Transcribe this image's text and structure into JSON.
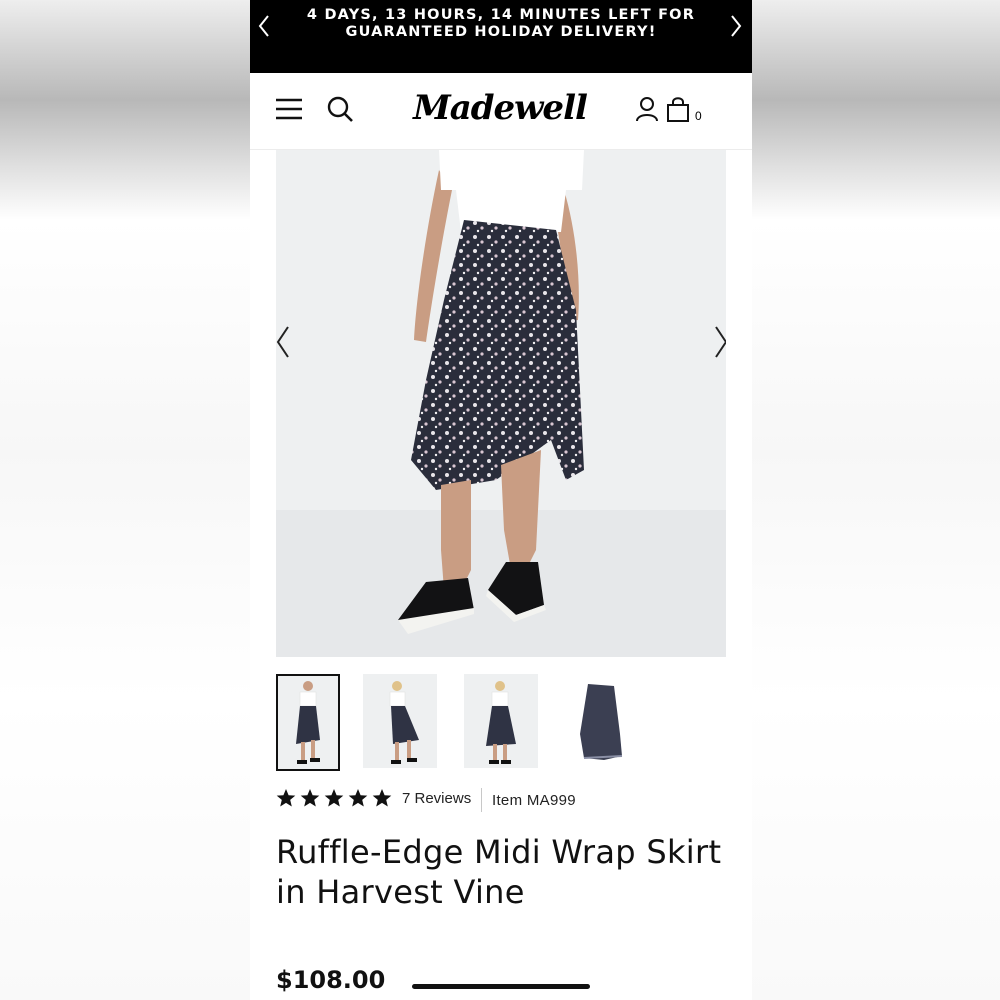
{
  "promo": {
    "line1": "4 DAYS, 13 HOURS, 14 MINUTES LEFT FOR",
    "line2": "GUARANTEED HOLIDAY DELIVERY!",
    "prev_icon": "chevron-left-icon",
    "next_icon": "chevron-right-icon"
  },
  "header": {
    "brand": "Madewell",
    "menu_icon": "hamburger-menu-icon",
    "search_icon": "search-icon",
    "account_icon": "user-icon",
    "bag_icon": "shopping-bag-icon",
    "bag_count": "0"
  },
  "gallery": {
    "prev_icon": "chevron-left-icon",
    "next_icon": "chevron-right-icon",
    "thumbnails": [
      "front-view",
      "side-walking-view",
      "back-view",
      "flat-lay-view"
    ],
    "active_thumbnail": 0
  },
  "product": {
    "rating": 5,
    "reviews_label": "7 Reviews",
    "item_number": "Item MA999",
    "title_line1": "Ruffle-Edge Midi Wrap Skirt",
    "title_line2": "in Harvest Vine",
    "price": "$108.00"
  },
  "colors": {
    "banner_bg": "#000000",
    "text": "#111111",
    "image_bg": "#eef0f1"
  }
}
